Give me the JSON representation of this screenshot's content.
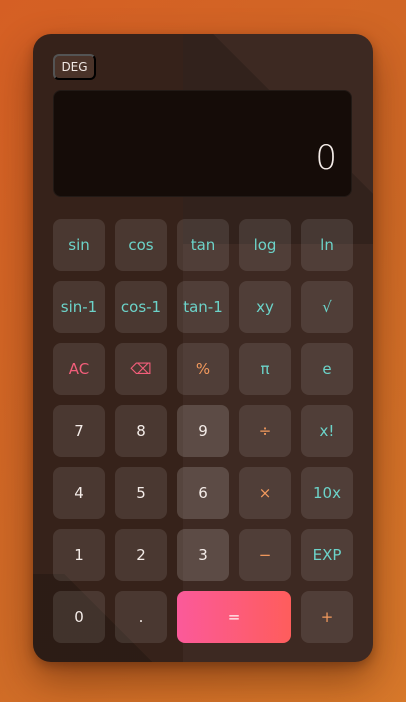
{
  "mode": "DEG",
  "display": {
    "value": "0"
  },
  "keys": [
    {
      "label": "sin",
      "kind": "sci",
      "name": "sin-key"
    },
    {
      "label": "cos",
      "kind": "sci",
      "name": "cos-key"
    },
    {
      "label": "tan",
      "kind": "sci",
      "name": "tan-key"
    },
    {
      "label": "log",
      "kind": "sci",
      "name": "log-key"
    },
    {
      "label": "ln",
      "kind": "sci",
      "name": "ln-key"
    },
    {
      "label": "sin-1",
      "kind": "sci",
      "name": "arcsin-key"
    },
    {
      "label": "cos-1",
      "kind": "sci",
      "name": "arccos-key"
    },
    {
      "label": "tan-1",
      "kind": "sci",
      "name": "arctan-key"
    },
    {
      "label": "xy",
      "kind": "sci",
      "name": "power-key"
    },
    {
      "label": "√",
      "kind": "sci",
      "name": "sqrt-key"
    },
    {
      "label": "AC",
      "kind": "danger",
      "name": "all-clear-key"
    },
    {
      "label": "⌫",
      "kind": "danger",
      "name": "backspace-key"
    },
    {
      "label": "%",
      "kind": "op",
      "name": "percent-key"
    },
    {
      "label": "π",
      "kind": "sci",
      "name": "pi-key"
    },
    {
      "label": "e",
      "kind": "sci",
      "name": "euler-key"
    },
    {
      "label": "7",
      "kind": "num",
      "name": "digit-7-key"
    },
    {
      "label": "8",
      "kind": "num",
      "name": "digit-8-key"
    },
    {
      "label": "9",
      "kind": "num",
      "name": "digit-9-key"
    },
    {
      "label": "÷",
      "kind": "op",
      "name": "divide-key"
    },
    {
      "label": "x!",
      "kind": "sci",
      "name": "factorial-key"
    },
    {
      "label": "4",
      "kind": "num",
      "name": "digit-4-key"
    },
    {
      "label": "5",
      "kind": "num",
      "name": "digit-5-key"
    },
    {
      "label": "6",
      "kind": "num",
      "name": "digit-6-key"
    },
    {
      "label": "×",
      "kind": "op",
      "name": "multiply-key"
    },
    {
      "label": "10x",
      "kind": "sci",
      "name": "ten-power-key"
    },
    {
      "label": "1",
      "kind": "num",
      "name": "digit-1-key"
    },
    {
      "label": "2",
      "kind": "num",
      "name": "digit-2-key"
    },
    {
      "label": "3",
      "kind": "num",
      "name": "digit-3-key"
    },
    {
      "label": "−",
      "kind": "op",
      "name": "subtract-key"
    },
    {
      "label": "EXP",
      "kind": "sci",
      "name": "exp-key"
    },
    {
      "label": "0",
      "kind": "num",
      "name": "digit-0-key"
    },
    {
      "label": ".",
      "kind": "num",
      "name": "decimal-key"
    },
    {
      "label": "=",
      "kind": "equals",
      "name": "equals-key"
    },
    {
      "label": "+",
      "kind": "op",
      "name": "add-key"
    }
  ],
  "colors": {
    "scientific_text": "#6cd3c9",
    "operator_text": "#f2995d",
    "clear_text": "#f25e7a",
    "equals_gradient_start": "#fb5a9a",
    "equals_gradient_end": "#fe5d5c"
  }
}
